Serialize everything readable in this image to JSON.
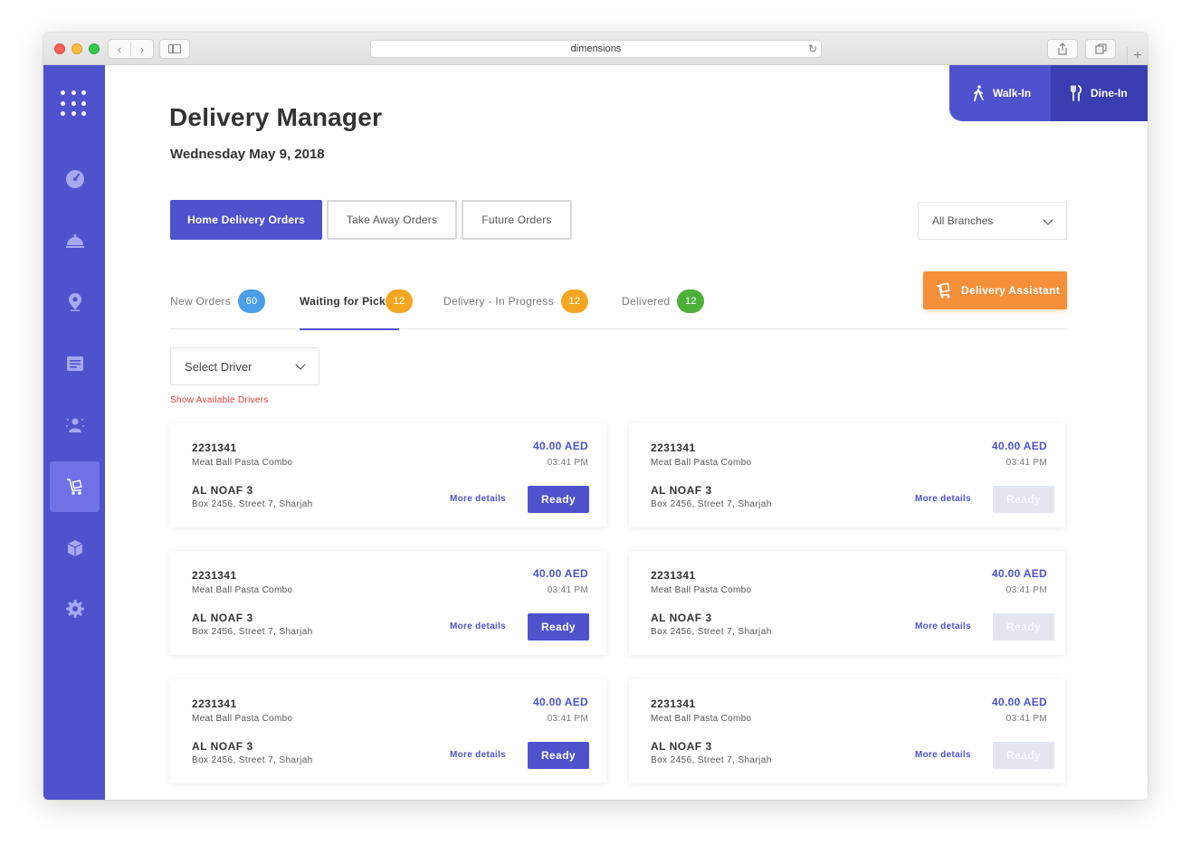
{
  "browser": {
    "url": "dimensions",
    "back_label": "‹",
    "forward_label": "›",
    "reload_label": "↻",
    "plus_label": "+"
  },
  "topbar": {
    "walk_in": "Walk-In",
    "dine_in": "Dine-In"
  },
  "page": {
    "title": "Delivery Manager",
    "date": "Wednesday May 9, 2018"
  },
  "order_types": {
    "home": "Home Delivery Orders",
    "take_away": "Take Away Orders",
    "future": "Future Orders"
  },
  "branch_select": {
    "value": "All Branches"
  },
  "assistant": {
    "label": "Delivery Assistant"
  },
  "status_tabs": [
    {
      "label": "New Orders",
      "count": "60",
      "color": "#4a9ee8"
    },
    {
      "label": "Waiting for Pick",
      "count": "12",
      "color": "#f5a623"
    },
    {
      "label": "Delivery - In Progress",
      "count": "12",
      "color": "#f5a623"
    },
    {
      "label": "Delivered",
      "count": "12",
      "color": "#4caf3a"
    }
  ],
  "driver_select": {
    "value": "Select Driver"
  },
  "show_drivers": "Show Available Drivers",
  "cards": [
    {
      "id": "2231341",
      "item": "Meat Ball Pasta Combo",
      "name": "AL NOAF 3",
      "address": "Box 2456, Street 7, Sharjah",
      "price": "40.00 AED",
      "time": "03:41 PM",
      "more": "More details",
      "action": "Ready"
    },
    {
      "id": "2231341",
      "item": "Meat Ball Pasta Combo",
      "name": "AL NOAF 3",
      "address": "Box 2456, Street 7, Sharjah",
      "price": "40.00 AED",
      "time": "03:41 PM",
      "more": "More details",
      "action": "Ready"
    },
    {
      "id": "2231341",
      "item": "Meat Ball Pasta Combo",
      "name": "AL NOAF 3",
      "address": "Box 2456, Street 7, Sharjah",
      "price": "40.00 AED",
      "time": "03:41 PM",
      "more": "More details",
      "action": "Ready"
    },
    {
      "id": "2231341",
      "item": "Meat Ball Pasta Combo",
      "name": "AL NOAF 3",
      "address": "Box 2456, Street 7, Sharjah",
      "price": "40.00 AED",
      "time": "03:41 PM",
      "more": "More details",
      "action": "Ready"
    },
    {
      "id": "2231341",
      "item": "Meat Ball Pasta Combo",
      "name": "AL NOAF 3",
      "address": "Box 2456, Street 7, Sharjah",
      "price": "40.00 AED",
      "time": "03:41 PM",
      "more": "More details",
      "action": "Ready"
    },
    {
      "id": "2231341",
      "item": "Meat Ball Pasta Combo",
      "name": "AL NOAF 3",
      "address": "Box 2456, Street 7, Sharjah",
      "price": "40.00 AED",
      "time": "03:41 PM",
      "more": "More details",
      "action": "Ready"
    }
  ],
  "colors": {
    "primary": "#4f52cd",
    "accent_orange": "#f58f3a",
    "disabled_button": "#e3e6ef"
  },
  "icons": {
    "sidebar": [
      "apps-grid-icon",
      "dashboard-gauge-icon",
      "food-cloche-icon",
      "location-pin-icon",
      "orders-list-icon",
      "customer-icon",
      "delivery-cart-icon",
      "package-icon",
      "settings-gear-icon"
    ]
  }
}
